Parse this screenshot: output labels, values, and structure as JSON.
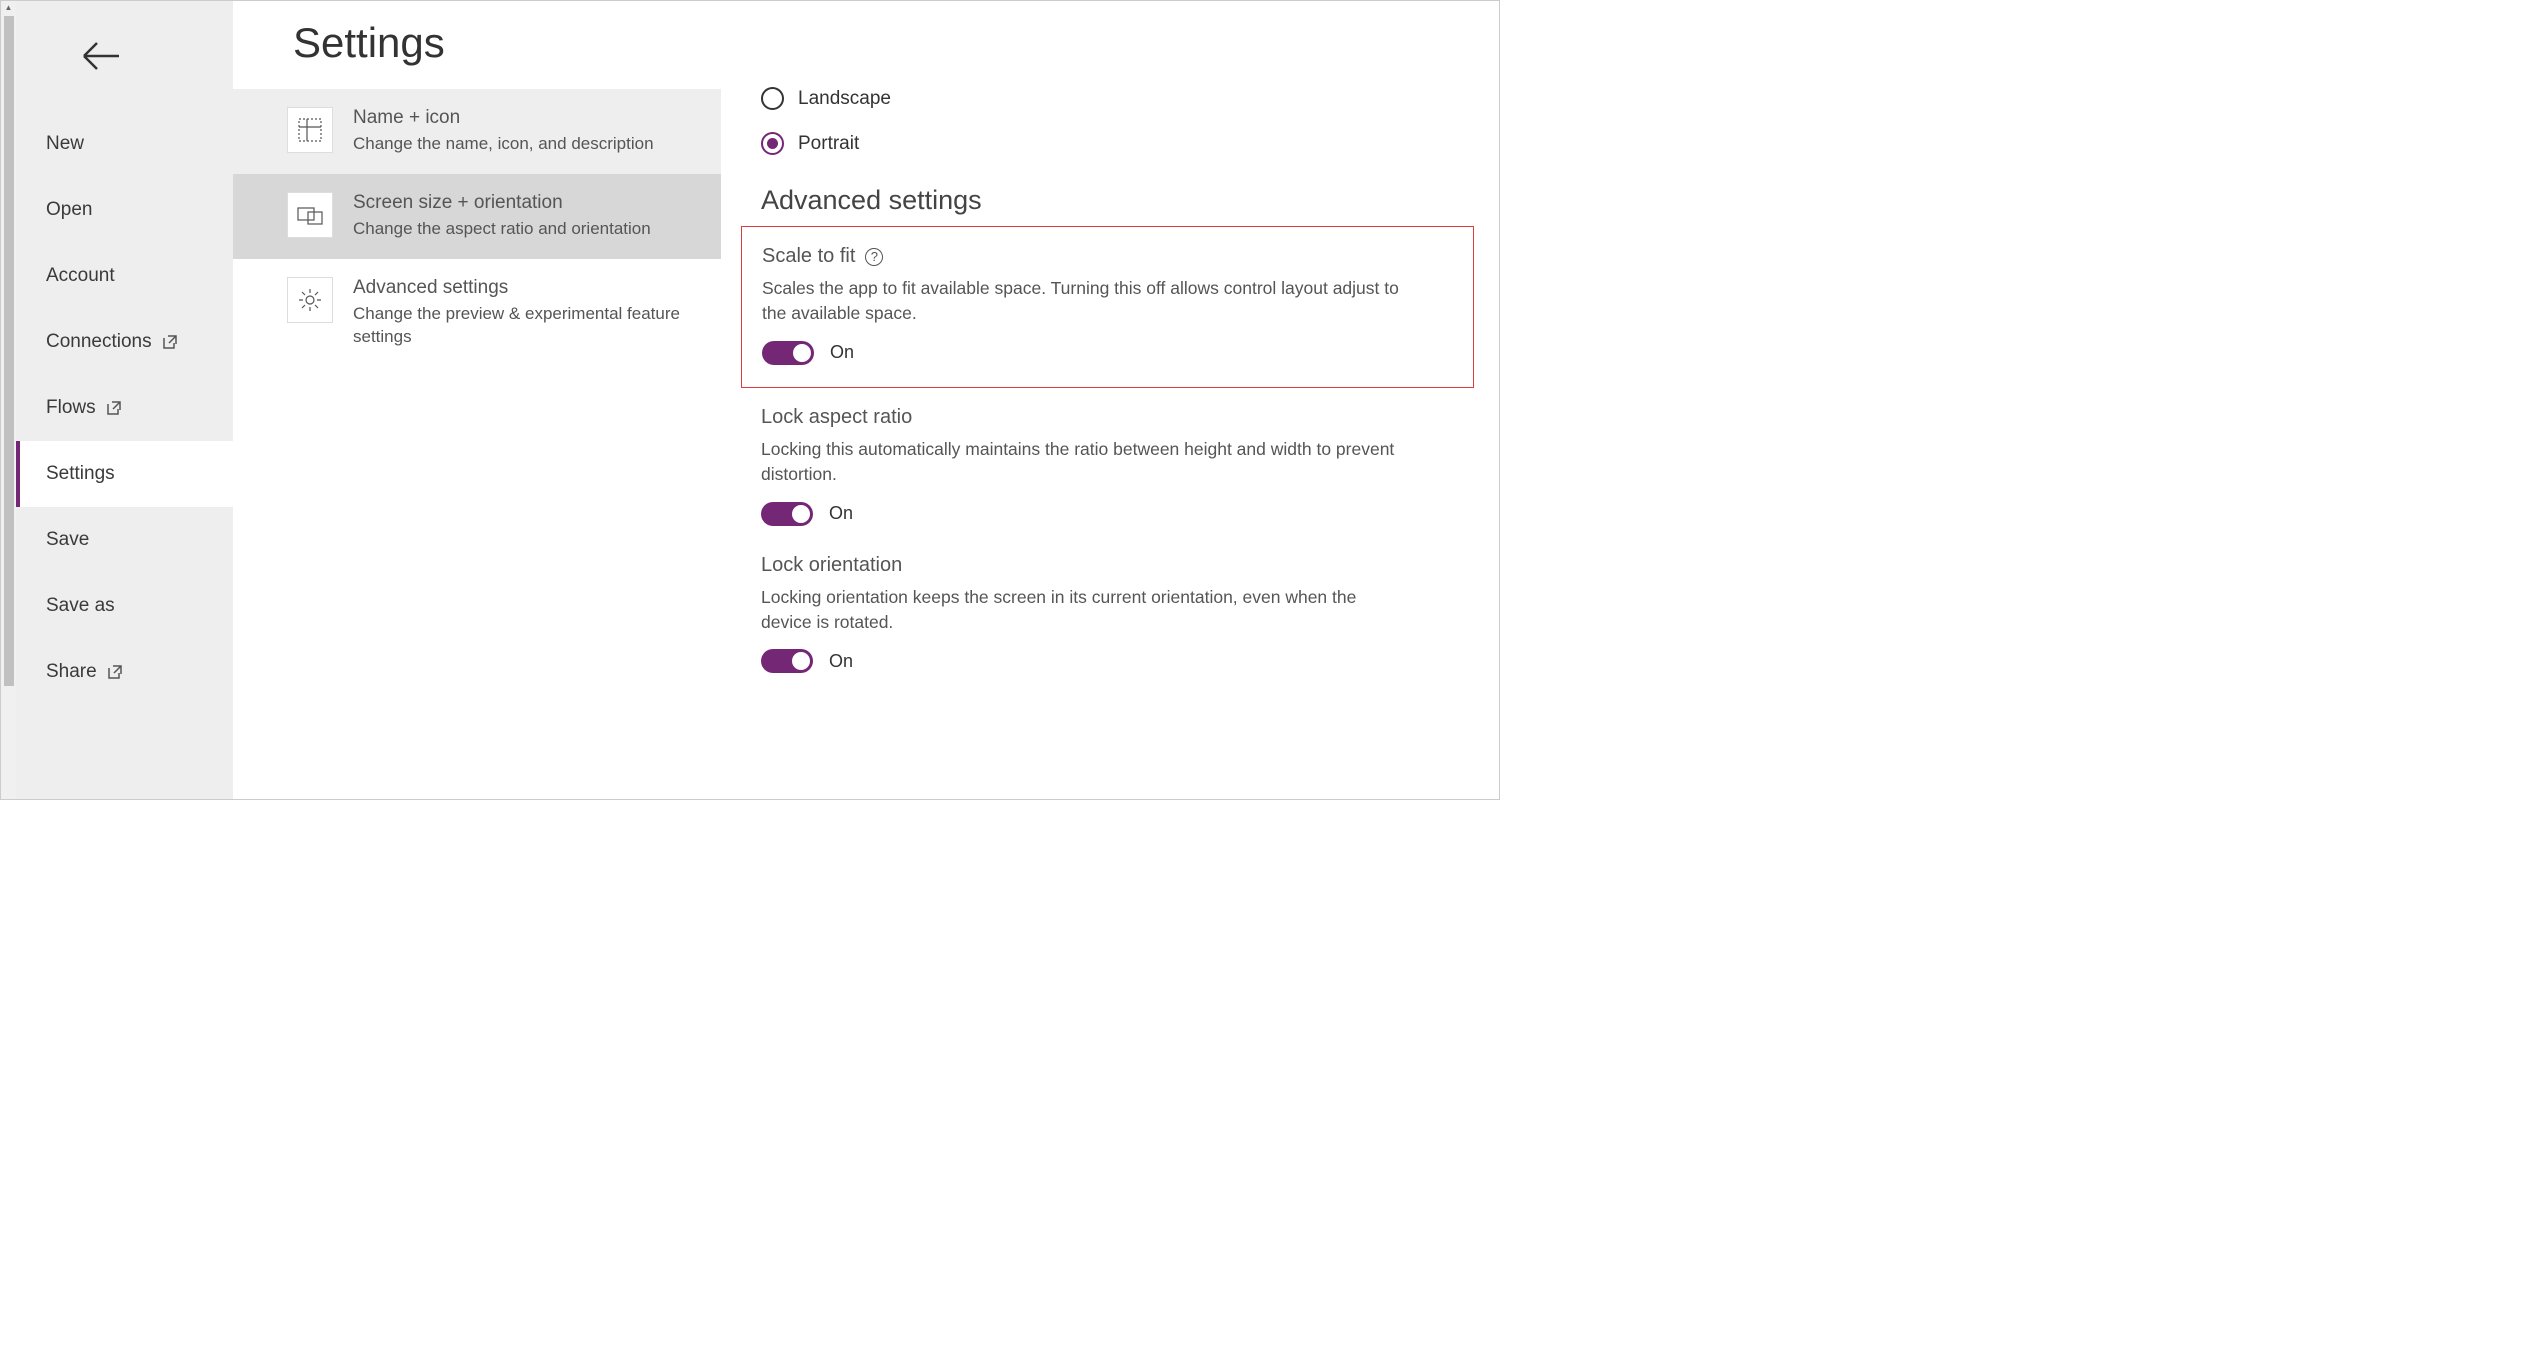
{
  "sidebar": {
    "items": [
      {
        "label": "New"
      },
      {
        "label": "Open"
      },
      {
        "label": "Account"
      },
      {
        "label": "Connections"
      },
      {
        "label": "Flows"
      },
      {
        "label": "Settings"
      },
      {
        "label": "Save"
      },
      {
        "label": "Save as"
      },
      {
        "label": "Share"
      }
    ],
    "selected": "Settings"
  },
  "page": {
    "title": "Settings"
  },
  "settings_cards": [
    {
      "title": "Name + icon",
      "desc": "Change the name, icon, and description"
    },
    {
      "title": "Screen size + orientation",
      "desc": "Change the aspect ratio and orientation"
    },
    {
      "title": "Advanced settings",
      "desc": "Change the preview & experimental feature settings"
    }
  ],
  "orientation": {
    "options": [
      {
        "label": "Landscape",
        "selected": false
      },
      {
        "label": "Portrait",
        "selected": true
      }
    ]
  },
  "advanced": {
    "heading": "Advanced settings",
    "scale_to_fit": {
      "title": "Scale to fit",
      "desc": "Scales the app to fit available space. Turning this off allows control layout adjust to the available space.",
      "state": "On"
    },
    "lock_aspect": {
      "title": "Lock aspect ratio",
      "desc": "Locking this automatically maintains the ratio between height and width to prevent distortion.",
      "state": "On"
    },
    "lock_orientation": {
      "title": "Lock orientation",
      "desc": "Locking orientation keeps the screen in its current orientation, even when the device is rotated.",
      "state": "On"
    }
  }
}
